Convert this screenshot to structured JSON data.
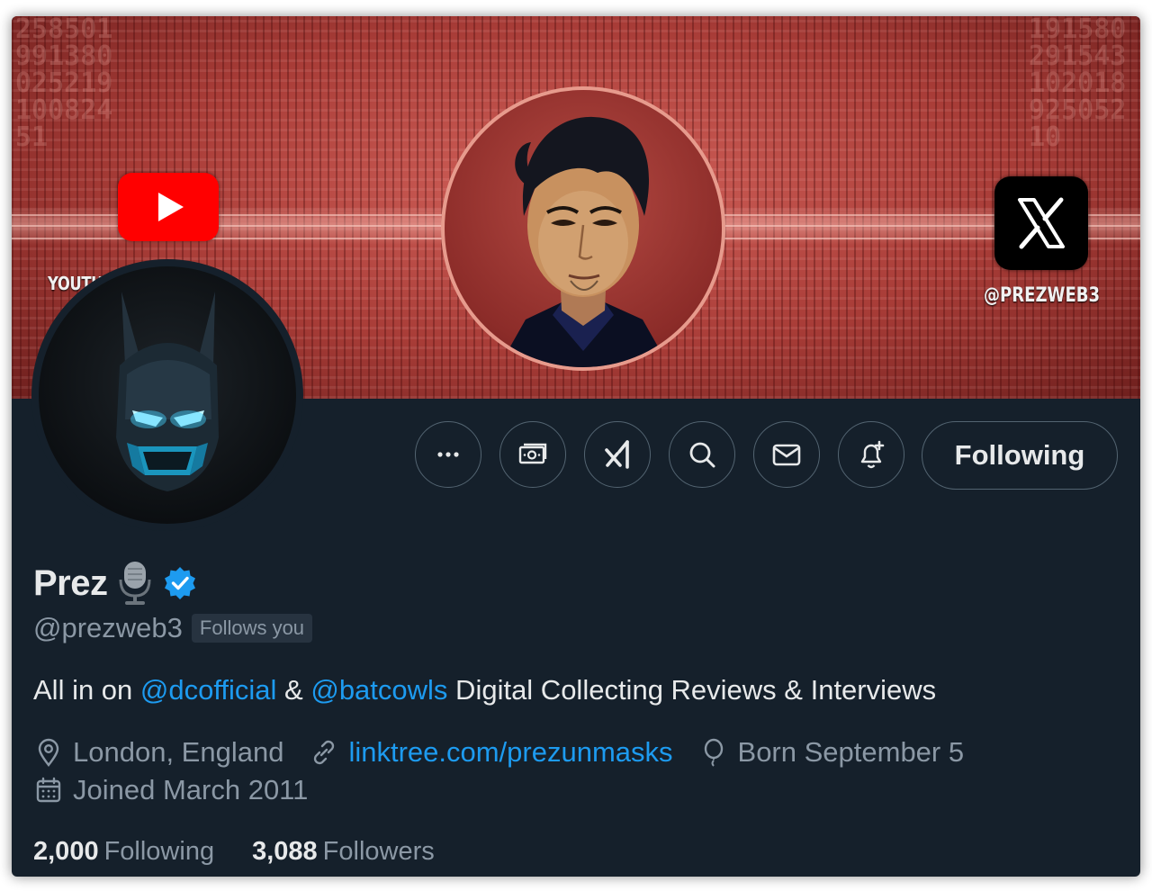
{
  "banner": {
    "youtube_label": "YOUTU           MASKS",
    "x_label": "@PREZWEB3",
    "digits_left": "25850199138002521910082451",
    "digits_right": "19158029154310201892505210"
  },
  "actions": {
    "more_icon": "more-horizontal-icon",
    "subscribe_icon": "money-card-icon",
    "grok_icon": "grok-icon",
    "search_icon": "search-icon",
    "message_icon": "mail-icon",
    "notify_icon": "bell-plus-icon",
    "follow_label": "Following"
  },
  "profile": {
    "name": "Prez",
    "name_emoji": "microphone-icon",
    "verified": "verified-badge-icon",
    "handle": "@prezweb3",
    "follows_you": "Follows you",
    "bio": {
      "part1": "All in on ",
      "mention1": "@dcofficial",
      "part2": " & ",
      "mention2": "@batcowls",
      "part3": " Digital Collecting Reviews & Interviews"
    },
    "location": "London, England",
    "website": "linktree.com/prezunmasks",
    "birthday": "Born September 5",
    "joined": "Joined March 2011"
  },
  "stats": {
    "following_count": "2,000",
    "following_label": "Following",
    "followers_count": "3,088",
    "followers_label": "Followers"
  },
  "colors": {
    "background": "#15202b",
    "accent": "#1d9bf0",
    "text_primary": "#e7e9ea",
    "text_secondary": "#8b98a5",
    "border": "#536471",
    "banner_red": "#a83c37"
  }
}
